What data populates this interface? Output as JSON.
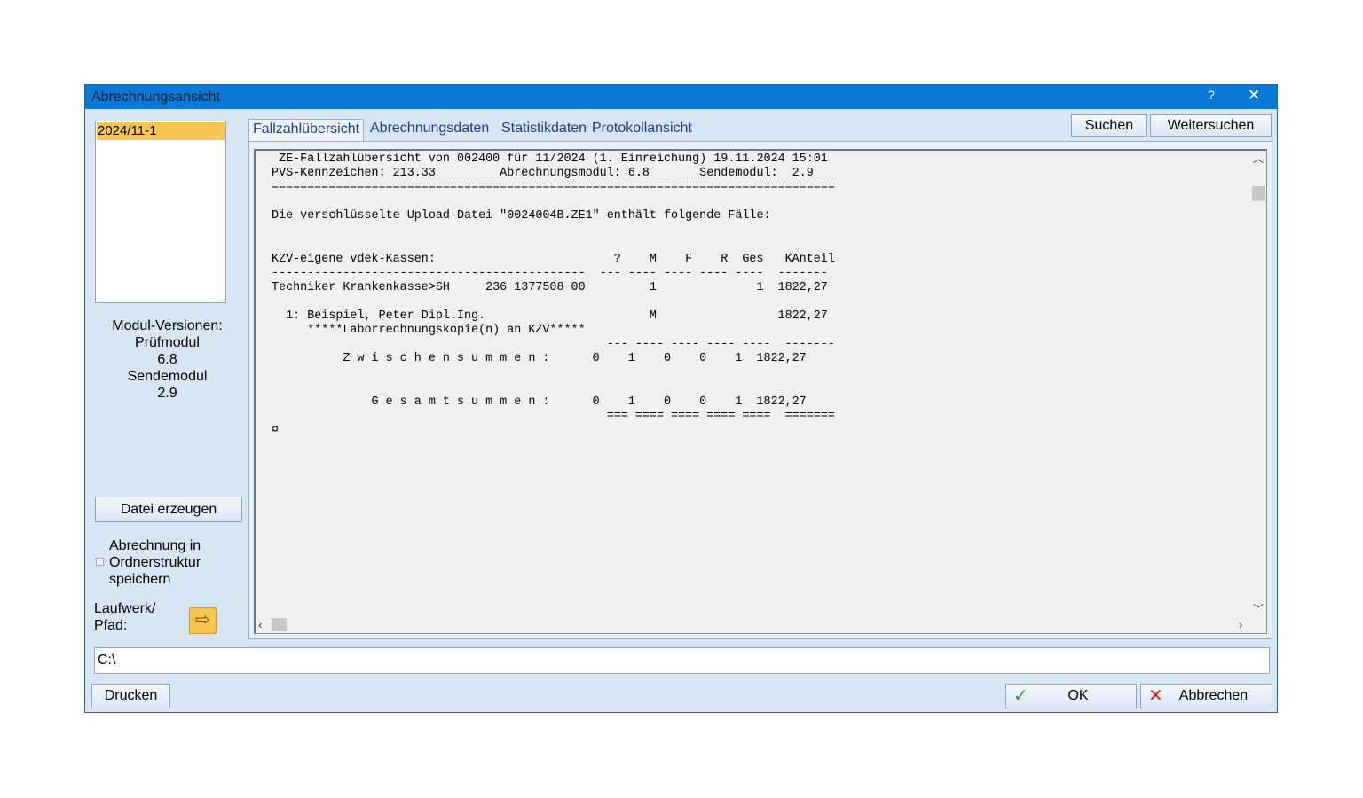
{
  "window": {
    "title": "Abrechnungsansicht",
    "help": "?",
    "close": "✕"
  },
  "periods": [
    "2024/11-1"
  ],
  "module_info": {
    "heading": "Modul-Versionen:",
    "pruef_label": "Prüfmodul",
    "pruef_version": "6.8",
    "sende_label": "Sendemodul",
    "sende_version": "2.9"
  },
  "buttons": {
    "datei": "Datei erzeugen",
    "suchen": "Suchen",
    "weitersuchen": "Weitersuchen",
    "drucken": "Drucken",
    "ok": "OK",
    "abbrechen": "Abbrechen"
  },
  "checkbox": {
    "label_line1": "Abrechnung in",
    "label_line2": "Ordnerstruktur",
    "label_line3": "speichern",
    "checked": false
  },
  "laufwerk": {
    "label_line1": "Laufwerk/",
    "label_line2": "Pfad:",
    "path": "C:\\"
  },
  "tabs": [
    {
      "label": "Fallzahlübersicht",
      "active": true
    },
    {
      "label": "Abrechnungsdaten",
      "active": false
    },
    {
      "label": "Statistikdaten",
      "active": false
    },
    {
      "label": "Protokollansicht",
      "active": false
    }
  ],
  "report_lines": [
    "  ZE-Fallzahlübersicht von 002400 für 11/2024 (1. Einreichung) 19.11.2024 15:01",
    " PVS-Kennzeichen: 213.33         Abrechnungsmodul: 6.8       Sendemodul:  2.9",
    " ===============================================================================",
    "",
    " Die verschlüsselte Upload-Datei \"0024004B.ZE1\" enthält folgende Fälle:",
    "",
    "",
    " KZV-eigene vdek-Kassen:                         ?    M    F    R  Ges   KAnteil",
    " --------------------------------------------  --- ---- ---- ---- ----  -------",
    " Techniker Krankenkasse>SH     236 1377508 00         1              1  1822,27",
    "",
    "   1: Beispiel, Peter Dipl.Ing.                       M                 1822,27",
    "      *****Laborrechnungskopie(n) an KZV*****",
    "                                                --- ---- ---- ---- ----  -------",
    "           Z w i s c h e n s u m m e n :      0    1    0    0    1  1822,27",
    "",
    "",
    "               G e s a m t s u m m e n :      0    1    0    0    1  1822,27",
    "                                                === ==== ==== ==== ====  =======",
    " ¤"
  ],
  "colors": {
    "titlebar": "#0a78d7",
    "selected_item": "#f9c74f",
    "tab_text": "#1a3d8f",
    "ok_check": "#2e9e3e",
    "cancel_x": "#d02020"
  },
  "icons": {
    "arrow_button": "arrow-right-icon",
    "ok": "check-icon",
    "cancel": "x-icon"
  }
}
